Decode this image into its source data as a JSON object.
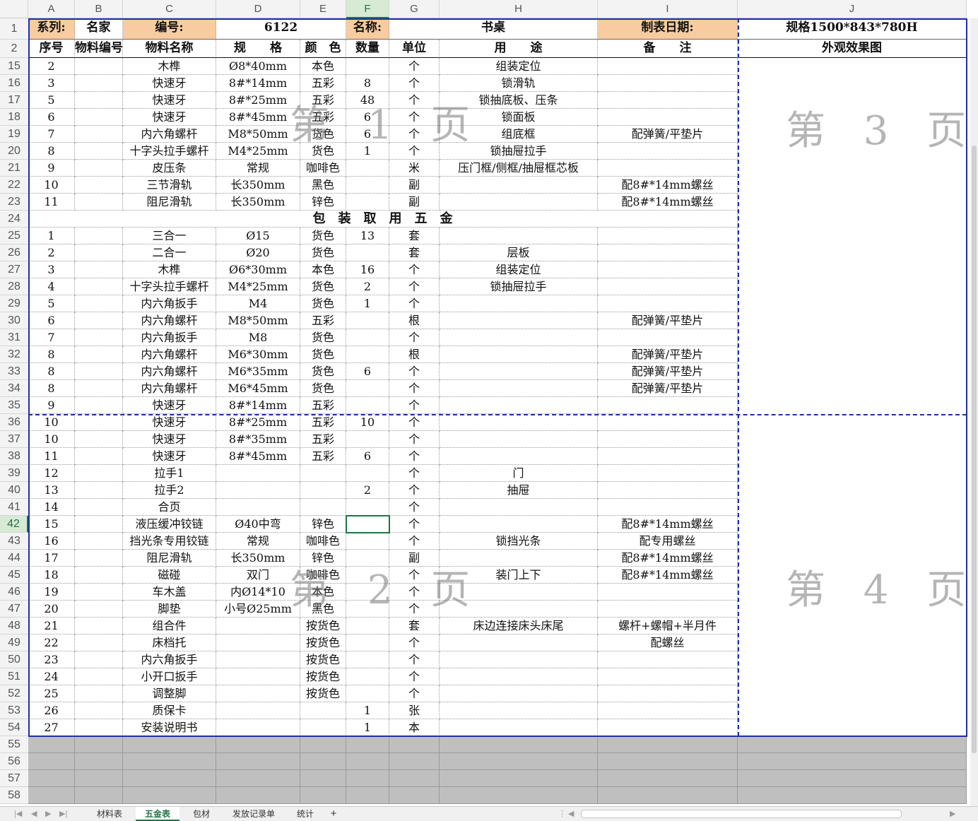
{
  "columns": [
    "A",
    "B",
    "C",
    "D",
    "E",
    "F",
    "G",
    "H",
    "I",
    "J"
  ],
  "selected_column": "F",
  "selected_row": "42",
  "header": {
    "series_label": "系列:",
    "series_value": "名家",
    "code_label": "编号:",
    "code_value": "6122",
    "name_label": "名称:",
    "name_value": "书桌",
    "date_label": "制表日期:",
    "spec": "规格1500*843*780H"
  },
  "col_headers": [
    "序号",
    "物料编号",
    "物料名称",
    "规　　格",
    "颜　色",
    "数量",
    "单位",
    "用　　途",
    "备　　注",
    "外观效果图"
  ],
  "section_title": "包　装　取　用　五　金",
  "rows": [
    {
      "r": "15",
      "c": [
        "2",
        "",
        "木榫",
        "Ø8*40mm",
        "本色",
        "",
        "个",
        "组装定位",
        ""
      ]
    },
    {
      "r": "16",
      "c": [
        "3",
        "",
        "快速牙",
        "8#*14mm",
        "五彩",
        "8",
        "个",
        "锁滑轨",
        ""
      ]
    },
    {
      "r": "17",
      "c": [
        "5",
        "",
        "快速牙",
        "8#*25mm",
        "五彩",
        "48",
        "个",
        "锁抽底板、压条",
        ""
      ]
    },
    {
      "r": "18",
      "c": [
        "6",
        "",
        "快速牙",
        "8#*45mm",
        "五彩",
        "6",
        "个",
        "锁面板",
        ""
      ]
    },
    {
      "r": "19",
      "c": [
        "7",
        "",
        "内六角螺杆",
        "M8*50mm",
        "货色",
        "6",
        "个",
        "组底框",
        "配弹簧/平垫片"
      ]
    },
    {
      "r": "20",
      "c": [
        "8",
        "",
        "十字头拉手螺杆",
        "M4*25mm",
        "货色",
        "1",
        "个",
        "锁抽屉拉手",
        ""
      ]
    },
    {
      "r": "21",
      "c": [
        "9",
        "",
        "皮压条",
        "常规",
        "咖啡色",
        "",
        "米",
        "压门框/侧框/抽屉框芯板",
        ""
      ]
    },
    {
      "r": "22",
      "c": [
        "10",
        "",
        "三节滑轨",
        "长350mm",
        "黑色",
        "",
        "副",
        "",
        "配8#*14mm螺丝"
      ]
    },
    {
      "r": "23",
      "c": [
        "11",
        "",
        "阻尼滑轨",
        "长350mm",
        "锌色",
        "",
        "副",
        "",
        "配8#*14mm螺丝"
      ]
    },
    {
      "r": "24",
      "section": true
    },
    {
      "r": "25",
      "c": [
        "1",
        "",
        "三合一",
        "Ø15",
        "货色",
        "13",
        "套",
        "",
        ""
      ]
    },
    {
      "r": "26",
      "c": [
        "2",
        "",
        "二合一",
        "Ø20",
        "货色",
        "",
        "套",
        "层板",
        ""
      ]
    },
    {
      "r": "27",
      "c": [
        "3",
        "",
        "木榫",
        "Ø6*30mm",
        "本色",
        "16",
        "个",
        "组装定位",
        ""
      ]
    },
    {
      "r": "28",
      "c": [
        "4",
        "",
        "十字头拉手螺杆",
        "M4*25mm",
        "货色",
        "2",
        "个",
        "锁抽屉拉手",
        ""
      ]
    },
    {
      "r": "29",
      "c": [
        "5",
        "",
        "内六角扳手",
        "M4",
        "货色",
        "1",
        "个",
        "",
        ""
      ]
    },
    {
      "r": "30",
      "c": [
        "6",
        "",
        "内六角螺杆",
        "M8*50mm",
        "五彩",
        "",
        "根",
        "",
        "配弹簧/平垫片"
      ]
    },
    {
      "r": "31",
      "c": [
        "7",
        "",
        "内六角扳手",
        "M8",
        "货色",
        "",
        "个",
        "",
        ""
      ]
    },
    {
      "r": "32",
      "c": [
        "8",
        "",
        "内六角螺杆",
        "M6*30mm",
        "货色",
        "",
        "根",
        "",
        "配弹簧/平垫片"
      ]
    },
    {
      "r": "33",
      "c": [
        "8",
        "",
        "内六角螺杆",
        "M6*35mm",
        "货色",
        "6",
        "个",
        "",
        "配弹簧/平垫片"
      ]
    },
    {
      "r": "34",
      "c": [
        "8",
        "",
        "内六角螺杆",
        "M6*45mm",
        "货色",
        "",
        "个",
        "",
        "配弹簧/平垫片"
      ]
    },
    {
      "r": "35",
      "c": [
        "9",
        "",
        "快速牙",
        "8#*14mm",
        "五彩",
        "",
        "个",
        "",
        ""
      ]
    },
    {
      "r": "36",
      "c": [
        "10",
        "",
        "快速牙",
        "8#*25mm",
        "五彩",
        "10",
        "个",
        "",
        ""
      ]
    },
    {
      "r": "37",
      "c": [
        "10",
        "",
        "快速牙",
        "8#*35mm",
        "五彩",
        "",
        "个",
        "",
        ""
      ]
    },
    {
      "r": "38",
      "c": [
        "11",
        "",
        "快速牙",
        "8#*45mm",
        "五彩",
        "6",
        "个",
        "",
        ""
      ]
    },
    {
      "r": "39",
      "c": [
        "12",
        "",
        "拉手1",
        "",
        "",
        "",
        "个",
        "门",
        ""
      ]
    },
    {
      "r": "40",
      "c": [
        "13",
        "",
        "拉手2",
        "",
        "",
        "2",
        "个",
        "抽屉",
        ""
      ]
    },
    {
      "r": "41",
      "c": [
        "14",
        "",
        "合页",
        "",
        "",
        "",
        "个",
        "",
        ""
      ]
    },
    {
      "r": "42",
      "c": [
        "15",
        "",
        "液压缓冲铰链",
        "Ø40中弯",
        "锌色",
        "",
        "个",
        "",
        "配8#*14mm螺丝"
      ]
    },
    {
      "r": "43",
      "c": [
        "16",
        "",
        "挡光条专用铰链",
        "常规",
        "咖啡色",
        "",
        "个",
        "锁挡光条",
        "配专用螺丝"
      ]
    },
    {
      "r": "44",
      "c": [
        "17",
        "",
        "阻尼滑轨",
        "长350mm",
        "锌色",
        "",
        "副",
        "",
        "配8#*14mm螺丝"
      ]
    },
    {
      "r": "45",
      "c": [
        "18",
        "",
        "磁碰",
        "双门",
        "咖啡色",
        "",
        "个",
        "装门上下",
        "配8#*14mm螺丝"
      ]
    },
    {
      "r": "46",
      "c": [
        "19",
        "",
        "车木盖",
        "内Ø14*10",
        "本色",
        "",
        "个",
        "",
        ""
      ]
    },
    {
      "r": "47",
      "c": [
        "20",
        "",
        "脚垫",
        "小号Ø25mm",
        "黑色",
        "",
        "个",
        "",
        ""
      ]
    },
    {
      "r": "48",
      "c": [
        "21",
        "",
        "组合件",
        "",
        "按货色",
        "",
        "套",
        "床边连接床头床尾",
        "螺杆+螺帽+半月件"
      ]
    },
    {
      "r": "49",
      "c": [
        "22",
        "",
        "床档托",
        "",
        "按货色",
        "",
        "个",
        "",
        "配螺丝"
      ]
    },
    {
      "r": "50",
      "c": [
        "23",
        "",
        "内六角扳手",
        "",
        "按货色",
        "",
        "个",
        "",
        ""
      ]
    },
    {
      "r": "51",
      "c": [
        "24",
        "",
        "小开口扳手",
        "",
        "按货色",
        "",
        "个",
        "",
        ""
      ]
    },
    {
      "r": "52",
      "c": [
        "25",
        "",
        "调整脚",
        "",
        "按货色",
        "",
        "个",
        "",
        ""
      ]
    },
    {
      "r": "53",
      "c": [
        "26",
        "",
        "质保卡",
        "",
        "",
        "1",
        "张",
        "",
        ""
      ]
    },
    {
      "r": "54",
      "c": [
        "27",
        "",
        "安装说明书",
        "",
        "",
        "1",
        "本",
        "",
        ""
      ]
    }
  ],
  "empty_rows": [
    "55",
    "56",
    "57",
    "58"
  ],
  "watermarks": [
    "第 1 页",
    "第 2 页",
    "第 3 页",
    "第 4 页"
  ],
  "sheet_tabs": [
    "材料表",
    "五金表",
    "包材",
    "发放记录单",
    "统计"
  ],
  "active_tab": "五金表",
  "add_sheet": "+",
  "colors": {
    "orange": "#f8cba0",
    "selection": "#217346",
    "page_break": "#1f2fa6",
    "gray_fill": "#bfbfbf"
  }
}
